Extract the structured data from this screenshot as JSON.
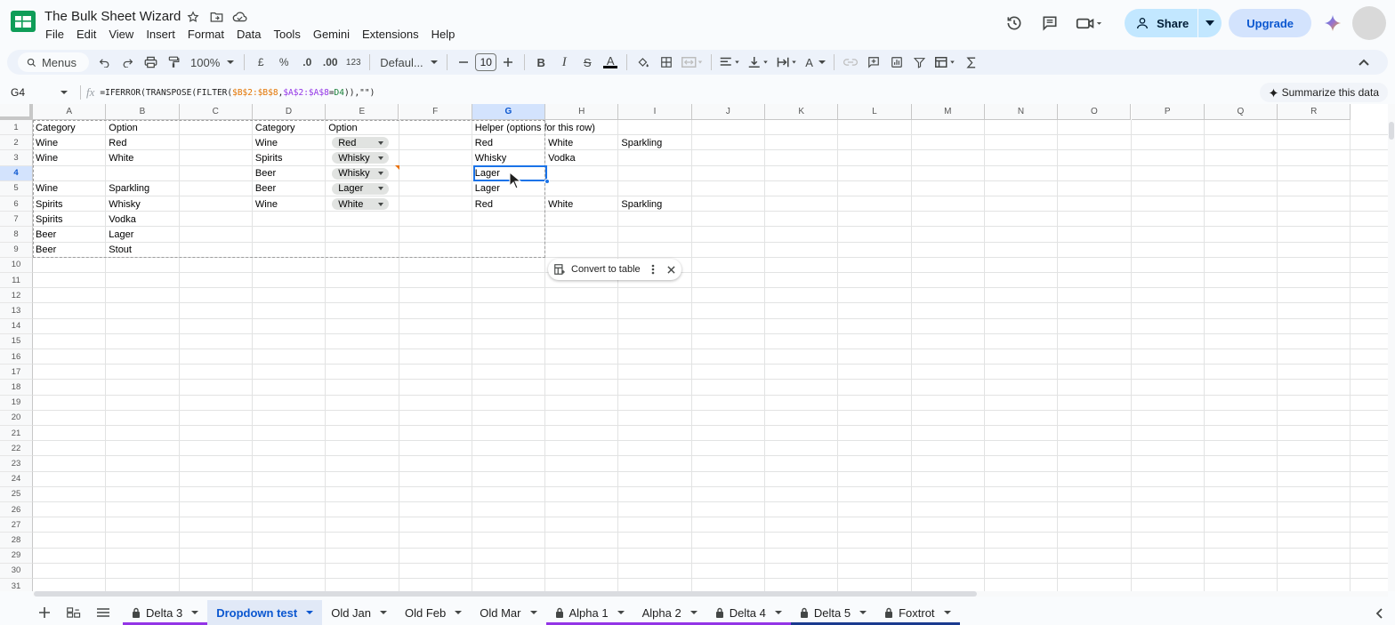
{
  "titlebar": {
    "doc_title": "The Bulk Sheet Wizard",
    "menu": [
      "File",
      "Edit",
      "View",
      "Insert",
      "Format",
      "Data",
      "Tools",
      "Gemini",
      "Extensions",
      "Help"
    ],
    "share_label": "Share",
    "upgrade_label": "Upgrade"
  },
  "toolbar": {
    "search_label": "Menus",
    "zoom": "100%",
    "currency": "£",
    "percent": "%",
    "dec_decrease": ".0",
    "dec_increase": ".00",
    "number_format": "123",
    "font": "Defaul...",
    "font_size": "10",
    "bold": "B",
    "italic": "I",
    "strike": "S",
    "text_color": "A",
    "text_rotate": "A"
  },
  "formula_bar": {
    "name_box": "G4",
    "fx": "fx",
    "formula": {
      "prefix": "=IFERROR(TRANSPOSE(FILTER(",
      "range1": "$B$2:$B$8",
      "comma1": ",",
      "range2": "$A$2:$A$8",
      "eq": "=",
      "ref": "D4",
      "mid": ")),",
      "str": "\"\"",
      "suffix": ")"
    },
    "summarize_label": "Summarize this data"
  },
  "grid": {
    "columns": [
      "A",
      "B",
      "C",
      "D",
      "E",
      "F",
      "G",
      "H",
      "I",
      "J",
      "K",
      "L",
      "M",
      "N",
      "O",
      "P",
      "Q",
      "R"
    ],
    "selected_column": "G",
    "selected_row": 4,
    "rows": [
      1,
      2,
      3,
      4,
      5,
      6,
      7,
      8,
      9,
      10,
      11,
      12,
      13,
      14,
      15,
      16,
      17,
      18,
      19,
      20,
      21,
      22,
      23,
      24,
      25,
      26,
      27,
      28,
      29,
      30,
      31
    ],
    "cells": {
      "A1": "Category",
      "B1": "Option",
      "D1": "Category",
      "E1": "Option",
      "G1": "Helper (options for this row)",
      "A2": "Wine",
      "B2": "Red",
      "D2": "Wine",
      "G2": "Red",
      "H2": "White",
      "I2": "Sparkling",
      "A3": "Wine",
      "B3": "White",
      "D3": "Spirits",
      "G3": "Whisky",
      "H3": "Vodka",
      "D4": "Beer",
      "G4": "Lager",
      "A5": "Wine",
      "B5": "Sparkling",
      "D5": "Beer",
      "G5": "Lager",
      "A6": "Spirits",
      "B6": "Whisky",
      "D6": "Wine",
      "G6": "Red",
      "H6": "White",
      "I6": "Sparkling",
      "A7": "Spirits",
      "B7": "Vodka",
      "A8": "Beer",
      "B8": "Lager",
      "A9": "Beer",
      "B9": "Stout"
    },
    "dropdowns": {
      "E2": "Red",
      "E3": "Whisky",
      "E4": "Whisky",
      "E5": "Lager",
      "E6": "White"
    },
    "convert_chip_label": "Convert to table"
  },
  "sheets": [
    {
      "name": "Delta 3",
      "locked": true,
      "underline": "#9334e6"
    },
    {
      "name": "Dropdown test",
      "locked": false,
      "active": true
    },
    {
      "name": "Old Jan",
      "locked": false
    },
    {
      "name": "Old Feb",
      "locked": false
    },
    {
      "name": "Old Mar",
      "locked": false
    },
    {
      "name": "Alpha 1",
      "locked": true,
      "underline": "#9334e6"
    },
    {
      "name": "Alpha 2",
      "locked": false,
      "underline": "#9334e6"
    },
    {
      "name": "Delta 4",
      "locked": true,
      "underline": "#9334e6"
    },
    {
      "name": "Delta 5",
      "locked": true,
      "underline": "#1a3a8f"
    },
    {
      "name": "Foxtrot",
      "locked": true,
      "underline": "#1a3a8f"
    }
  ],
  "colors": {
    "accent": "#0b57d0",
    "selection": "#1a73e8",
    "share_bg": "#c2e7ff",
    "sheets_green": "#0f9d58"
  }
}
